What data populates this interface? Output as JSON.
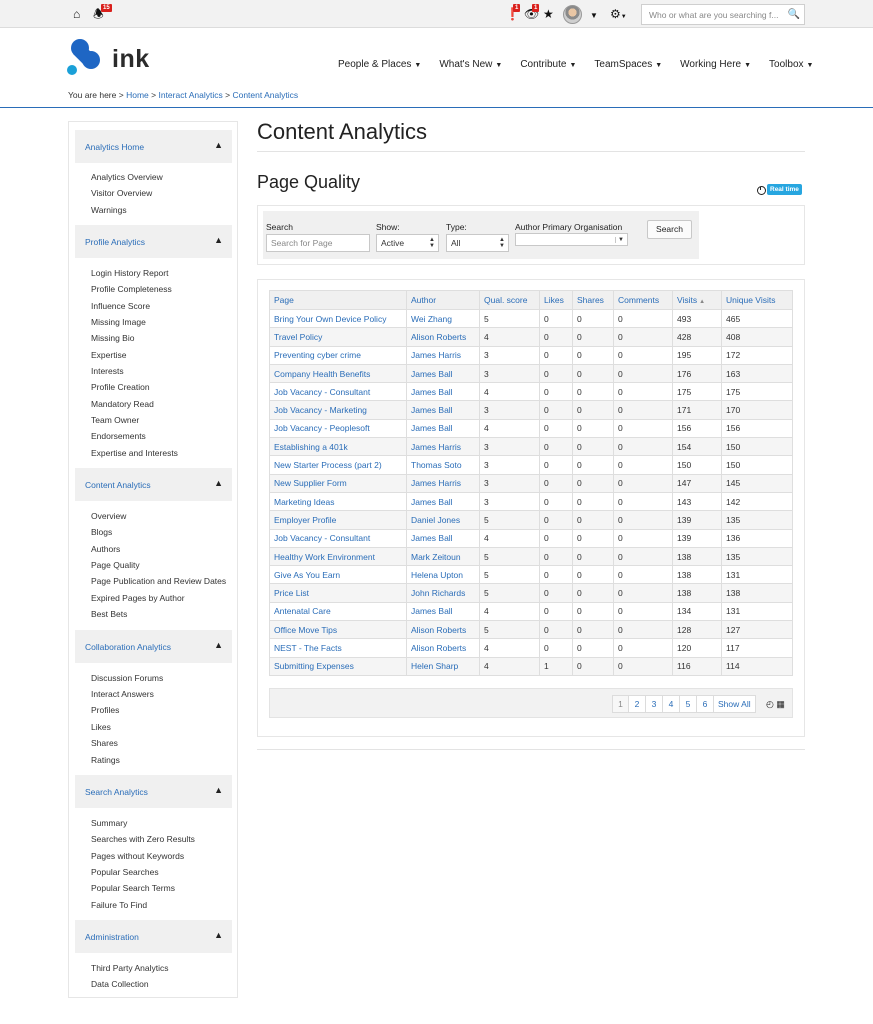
{
  "topbar": {
    "notifications_count": "15",
    "alerts_count": "1",
    "watch_count": "1",
    "search_placeholder": "Who or what are you searching f..."
  },
  "brand": {
    "name": "ink"
  },
  "nav": {
    "items": [
      {
        "label": "People & Places"
      },
      {
        "label": "What's New"
      },
      {
        "label": "Contribute"
      },
      {
        "label": "TeamSpaces"
      },
      {
        "label": "Working Here"
      },
      {
        "label": "Toolbox"
      }
    ]
  },
  "breadcrumb": {
    "prefix": "You are here >",
    "items": [
      "Home",
      "Interact Analytics",
      "Content Analytics"
    ],
    "separator_1": ">",
    "separator_2": ">"
  },
  "sidebar": {
    "sections": [
      {
        "title": "Analytics Home",
        "items": [
          "Analytics Overview",
          "Visitor Overview",
          "Warnings"
        ]
      },
      {
        "title": "Profile Analytics",
        "items": [
          "Login History Report",
          "Profile Completeness",
          "Influence Score",
          "Missing Image",
          "Missing Bio",
          "Expertise",
          "Interests",
          "Profile Creation",
          "Mandatory Read",
          "Team Owner",
          "Endorsements",
          "Expertise and Interests"
        ]
      },
      {
        "title": "Content Analytics",
        "items": [
          "Overview",
          "Blogs",
          "Authors",
          "Page Quality",
          "Page Publication and Review Dates",
          "Expired Pages by Author",
          "Best Bets"
        ]
      },
      {
        "title": "Collaboration Analytics",
        "items": [
          "Discussion Forums",
          "Interact Answers",
          "Profiles",
          "Likes",
          "Shares",
          "Ratings"
        ]
      },
      {
        "title": "Search Analytics",
        "items": [
          "Summary",
          "Searches with Zero Results",
          "Pages without Keywords",
          "Popular Searches",
          "Popular Search Terms",
          "Failure To Find"
        ]
      },
      {
        "title": "Administration",
        "items": [
          "Third Party Analytics",
          "Data Collection"
        ]
      }
    ]
  },
  "main": {
    "page_title": "Content Analytics",
    "section_title": "Page Quality",
    "realtime_label": "Real time"
  },
  "filters": {
    "search_label": "Search",
    "search_placeholder": "Search for Page",
    "show_label": "Show:",
    "show_value": "Active",
    "type_label": "Type:",
    "type_value": "All",
    "org_label": "Author Primary Organisation",
    "org_value": "",
    "search_button": "Search"
  },
  "table": {
    "columns": [
      "Page",
      "Author",
      "Qual. score",
      "Likes",
      "Shares",
      "Comments",
      "Visits",
      "Unique Visits"
    ],
    "rows": [
      [
        "Bring Your Own Device Policy",
        "Wei Zhang",
        "5",
        "0",
        "0",
        "0",
        "493",
        "465"
      ],
      [
        "Travel Policy",
        "Alison Roberts",
        "4",
        "0",
        "0",
        "0",
        "428",
        "408"
      ],
      [
        "Preventing cyber crime",
        "James Harris",
        "3",
        "0",
        "0",
        "0",
        "195",
        "172"
      ],
      [
        "Company Health Benefits",
        "James Ball",
        "3",
        "0",
        "0",
        "0",
        "176",
        "163"
      ],
      [
        "Job Vacancy - Consultant",
        "James Ball",
        "4",
        "0",
        "0",
        "0",
        "175",
        "175"
      ],
      [
        "Job Vacancy - Marketing",
        "James Ball",
        "3",
        "0",
        "0",
        "0",
        "171",
        "170"
      ],
      [
        "Job Vacancy - Peoplesoft",
        "James Ball",
        "4",
        "0",
        "0",
        "0",
        "156",
        "156"
      ],
      [
        "Establishing a 401k",
        "James Harris",
        "3",
        "0",
        "0",
        "0",
        "154",
        "150"
      ],
      [
        "New Starter Process (part 2)",
        "Thomas Soto",
        "3",
        "0",
        "0",
        "0",
        "150",
        "150"
      ],
      [
        "New Supplier Form",
        "James Harris",
        "3",
        "0",
        "0",
        "0",
        "147",
        "145"
      ],
      [
        "Marketing Ideas",
        "James Ball",
        "3",
        "0",
        "0",
        "0",
        "143",
        "142"
      ],
      [
        "Employer Profile",
        "Daniel Jones",
        "5",
        "0",
        "0",
        "0",
        "139",
        "135"
      ],
      [
        "Job Vacancy - Consultant",
        "James Ball",
        "4",
        "0",
        "0",
        "0",
        "139",
        "136"
      ],
      [
        "Healthy Work Environment",
        "Mark Zeitoun",
        "5",
        "0",
        "0",
        "0",
        "138",
        "135"
      ],
      [
        "Give As You Earn",
        "Helena Upton",
        "5",
        "0",
        "0",
        "0",
        "138",
        "131"
      ],
      [
        "Price List",
        "John Richards",
        "5",
        "0",
        "0",
        "0",
        "138",
        "138"
      ],
      [
        "Antenatal Care",
        "James Ball",
        "4",
        "0",
        "0",
        "0",
        "134",
        "131"
      ],
      [
        "Office Move Tips",
        "Alison Roberts",
        "5",
        "0",
        "0",
        "0",
        "128",
        "127"
      ],
      [
        "NEST - The Facts",
        "Alison Roberts",
        "4",
        "0",
        "0",
        "0",
        "120",
        "117"
      ],
      [
        "Submitting Expenses",
        "Helen Sharp",
        "4",
        "1",
        "0",
        "0",
        "116",
        "114"
      ]
    ]
  },
  "pager": {
    "pages": [
      "1",
      "2",
      "3",
      "4",
      "5",
      "6"
    ],
    "show_all": "Show All"
  }
}
